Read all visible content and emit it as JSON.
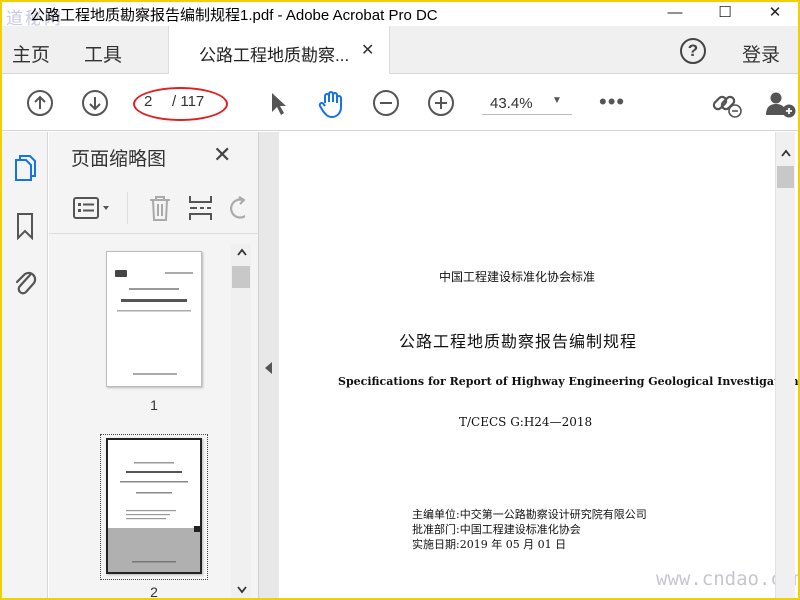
{
  "window": {
    "title": "公路工程地质勘察报告编制规程1.pdf - Adobe Acrobat Pro DC",
    "watermark_top": "道秘网",
    "minimize": "—",
    "maximize": "☐",
    "close": "✕"
  },
  "menubar": {
    "home": "主页",
    "tools": "工具",
    "doc_tab_label": "公路工程地质勘察...",
    "doc_tab_close": "✕",
    "help": "?",
    "login": "登录"
  },
  "toolbar": {
    "current_page": "2",
    "page_total": "/ 117",
    "zoom": "43.4%",
    "zoom_caret": "▼",
    "more": "•••"
  },
  "thumbnails_panel": {
    "title": "页面缩略图",
    "close": "✕",
    "thumbs": [
      {
        "label": "1"
      },
      {
        "label": "2"
      }
    ]
  },
  "document": {
    "org_standard": "中国工程建设标准化协会标准",
    "title_cn": "公路工程地质勘察报告编制规程",
    "title_en": "Specifications for Report of Highway Engineering Geological Investigation",
    "std_no": "T/CECS  G:H24—2018",
    "editor": "主编单位:中交第一公路勘察设计研究院有限公司",
    "approver": "批准部门:中国工程建设标准化协会",
    "effective_date": "实施日期:2019 年 05 月 01 日"
  },
  "watermark_bottom": "www.cndao.com",
  "colors": {
    "border_yellow": "#f0d000",
    "hand_tool_blue": "#1473e6",
    "highlight_red": "#e02020"
  }
}
